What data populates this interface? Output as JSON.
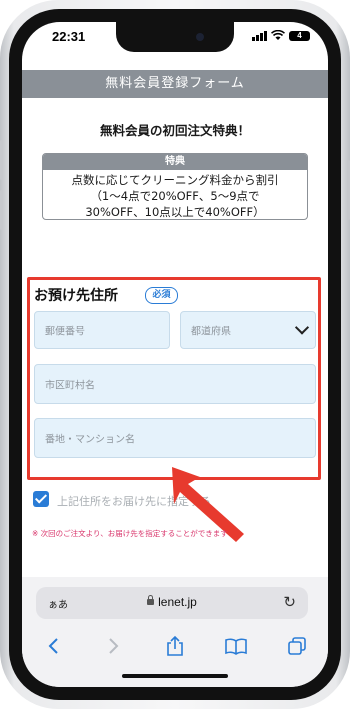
{
  "status_bar": {
    "time": "22:31",
    "battery": "4"
  },
  "header": {
    "title": "無料会員登録フォーム"
  },
  "promo": {
    "title": "無料会員の初回注文特典！",
    "tag": "特典",
    "lines": [
      "点数に応じてクリーニング料金から割引",
      "（1〜4点で20%OFF、5〜9点で",
      "30%OFF、10点以上で40%OFF）"
    ]
  },
  "address_section": {
    "title": "お預け先住所",
    "required_badge": "必須",
    "postal_code_placeholder": "郵便番号",
    "prefecture_placeholder": "都道府県",
    "city_placeholder": "市区町村名",
    "street_placeholder": "番地・マンション名"
  },
  "same_address": {
    "label": "上記住所をお届け先に指定する",
    "checked": true
  },
  "note": "※ 次回のご注文より、お届け先を指定することができます",
  "browser": {
    "text_size_label": "ぁあ",
    "url": "lenet.jp"
  },
  "icons": {
    "reload": "reload-icon",
    "back": "back-icon",
    "forward": "forward-icon",
    "share": "share-icon",
    "bookmarks": "bookmarks-icon",
    "tabs": "tabs-icon"
  },
  "colors": {
    "accent": "#2a7cd6",
    "highlight": "#e73a2e",
    "header": "#8a9097",
    "field": "#e5f2fb",
    "note": "#d9366c"
  }
}
